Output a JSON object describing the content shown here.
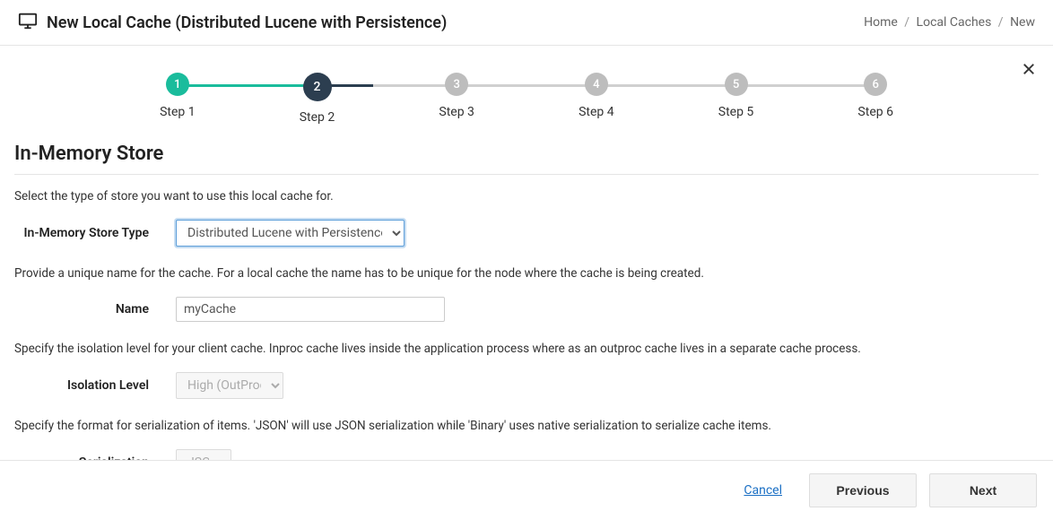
{
  "header": {
    "title": "New Local Cache (Distributed Lucene with Persistence)",
    "breadcrumb": {
      "home": "Home",
      "localCaches": "Local Caches",
      "new": "New"
    }
  },
  "stepper": {
    "steps": [
      {
        "num": "1",
        "label": "Step 1",
        "state": "done",
        "line": "done"
      },
      {
        "num": "2",
        "label": "Step 2",
        "state": "current",
        "line": "partial"
      },
      {
        "num": "3",
        "label": "Step 3",
        "state": "pending",
        "line": "pending"
      },
      {
        "num": "4",
        "label": "Step 4",
        "state": "pending",
        "line": "pending"
      },
      {
        "num": "5",
        "label": "Step 5",
        "state": "pending",
        "line": "pending"
      },
      {
        "num": "6",
        "label": "Step 6",
        "state": "pending",
        "line": "none"
      }
    ]
  },
  "section": {
    "title": "In-Memory Store",
    "desc1": "Select the type of store you want to use this local cache for.",
    "storeTypeLabel": "In-Memory Store Type",
    "storeTypeValue": "Distributed Lucene with Persistence",
    "desc2": "Provide a unique name for the cache. For a local cache the name has to be unique for the node where the cache is being created.",
    "nameLabel": "Name",
    "nameValue": "myCache",
    "desc3": "Specify the isolation level for your client cache. Inproc cache lives inside the application process where as an outproc cache lives in a separate cache process.",
    "isoLabel": "Isolation Level",
    "isoValue": "High (OutProc)",
    "desc4": "Specify the format for serialization of items. 'JSON' will use JSON serialization while 'Binary' uses native serialization to serialize cache items.",
    "serLabel": "Serialization",
    "serValue": "JSON"
  },
  "footer": {
    "cancel": "Cancel",
    "previous": "Previous",
    "next": "Next"
  }
}
